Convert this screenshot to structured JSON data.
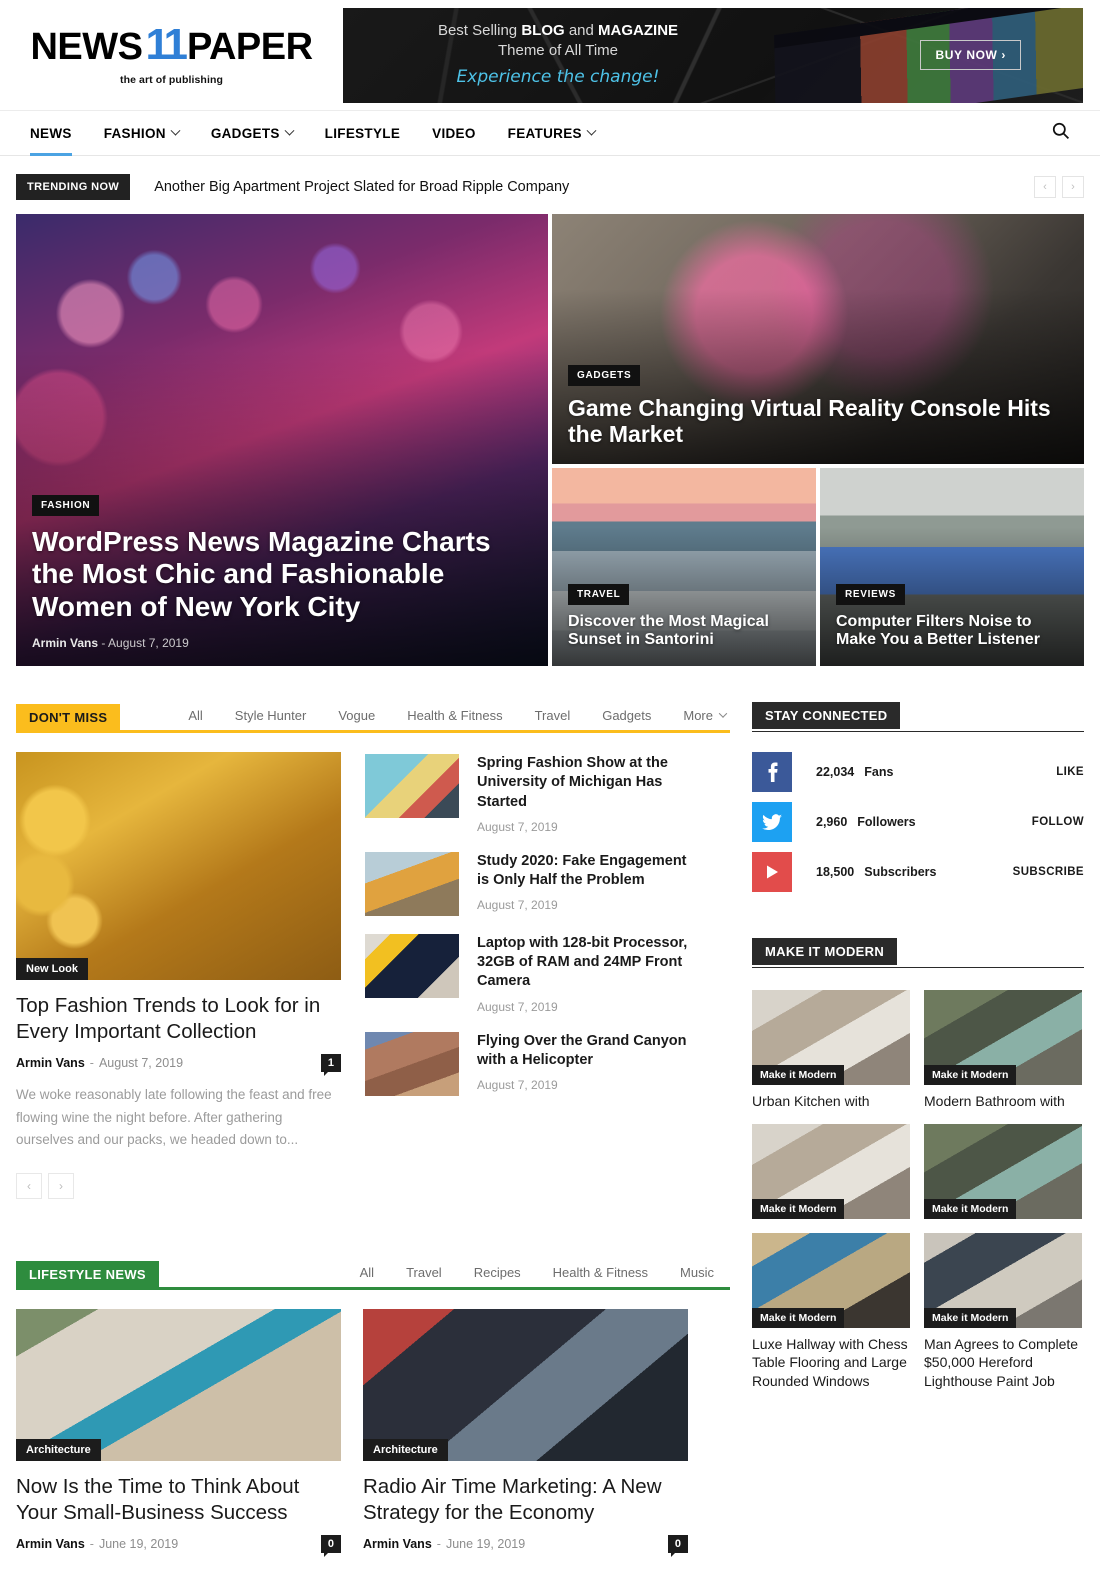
{
  "header": {
    "logo_first": "NEWS",
    "logo_eleven": "11",
    "logo_last": "PAPER",
    "logo_tagline": "the art of publishing",
    "ad": {
      "line1_pre": "Best Selling ",
      "line1_b1": "BLOG",
      "line1_mid": " and ",
      "line1_b2": "MAGAZINE",
      "line2": "Theme of All Time",
      "line3": "Experience the change!",
      "cta": "BUY NOW  ›"
    }
  },
  "nav": {
    "items": [
      {
        "label": "NEWS",
        "caret": false,
        "active": true
      },
      {
        "label": "FASHION",
        "caret": true,
        "active": false
      },
      {
        "label": "GADGETS",
        "caret": true,
        "active": false
      },
      {
        "label": "LIFESTYLE",
        "caret": false,
        "active": false
      },
      {
        "label": "VIDEO",
        "caret": false,
        "active": false
      },
      {
        "label": "FEATURES",
        "caret": true,
        "active": false
      }
    ],
    "search_icon": "search-icon"
  },
  "trending": {
    "badge": "TRENDING NOW",
    "headline": "Another Big Apartment Project Slated for Broad Ripple Company",
    "prev": "‹",
    "next": "›"
  },
  "hero": {
    "main": {
      "category": "FASHION",
      "title": "WordPress News Magazine Charts the Most Chic and Fashionable Women of New York City",
      "author": "Armin Vans",
      "dash": "-",
      "date": "August 7, 2019"
    },
    "top": {
      "category": "GADGETS",
      "title": "Game Changing Virtual Reality Console Hits the Market"
    },
    "bottom": [
      {
        "category": "TRAVEL",
        "title": "Discover the Most Magical Sunset in Santorini"
      },
      {
        "category": "REVIEWS",
        "title": "Computer Filters Noise to Make You a Better Listener"
      }
    ]
  },
  "dont_miss": {
    "badge": "DON'T MISS",
    "tabs": [
      "All",
      "Style Hunter",
      "Vogue",
      "Health & Fitness",
      "Travel",
      "Gadgets"
    ],
    "more": "More",
    "feature": {
      "tag": "New Look",
      "title": "Top Fashion Trends to Look for in Every Important Collection",
      "author": "Armin Vans",
      "dash": "-",
      "date": "August 7, 2019",
      "comments": "1",
      "excerpt": "We woke reasonably late following the feast and free flowing wine the night before. After gathering ourselves and our packs, we headed down to..."
    },
    "pager": {
      "prev": "‹",
      "next": "›"
    },
    "list": [
      {
        "title": "Spring Fashion Show at the University of Michigan Has Started",
        "date": "August 7, 2019",
        "thumb": "img-michigan"
      },
      {
        "title": "Study 2020: Fake Engagement is Only Half the Problem",
        "date": "August 7, 2019",
        "thumb": "img-study"
      },
      {
        "title": "Laptop with 128-bit Processor, 32GB of RAM and 24MP Front Camera",
        "date": "August 7, 2019",
        "thumb": "img-laptop"
      },
      {
        "title": "Flying Over the Grand Canyon with a Helicopter",
        "date": "August 7, 2019",
        "thumb": "img-canyon"
      }
    ]
  },
  "lifestyle": {
    "badge": "LIFESTYLE NEWS",
    "tabs": [
      "All",
      "Travel",
      "Recipes",
      "Health & Fitness",
      "Music"
    ],
    "cards": [
      {
        "tag": "Architecture",
        "title": "Now Is the Time to Think About Your Small-Business Success",
        "author": "Armin Vans",
        "dash": "-",
        "date": "June 19, 2019",
        "comments": "0",
        "thumb": "img-villa"
      },
      {
        "tag": "Architecture",
        "title": "Radio Air Time Marketing: A New Strategy for the Economy",
        "author": "Armin Vans",
        "dash": "-",
        "date": "June 19, 2019",
        "comments": "0",
        "thumb": "img-dj"
      }
    ]
  },
  "sidebar": {
    "stay_connected": {
      "title": "STAY CONNECTED",
      "rows": [
        {
          "icon": "facebook-icon",
          "count": "22,034",
          "label": "Fans",
          "action": "LIKE",
          "color": "#3b5999"
        },
        {
          "icon": "twitter-icon",
          "count": "2,960",
          "label": "Followers",
          "action": "FOLLOW",
          "color": "#1da1f2"
        },
        {
          "icon": "youtube-icon",
          "count": "18,500",
          "label": "Subscribers",
          "action": "SUBSCRIBE",
          "color": "#e24c4b"
        }
      ]
    },
    "make_it_modern": {
      "title": "MAKE IT MODERN",
      "items": [
        {
          "tag": "Make it Modern",
          "title": "Urban Kitchen with",
          "thumb": "img-kitchen"
        },
        {
          "tag": "Make it Modern",
          "title": "Modern Bathroom with",
          "thumb": "img-bath"
        },
        {
          "tag": "Make it Modern",
          "title": "",
          "thumb": "img-kitchen"
        },
        {
          "tag": "Make it Modern",
          "title": "",
          "thumb": "img-bath"
        },
        {
          "tag": "Make it Modern",
          "title": "Luxe Hallway with Chess Table Flooring and Large Rounded Windows",
          "thumb": "img-hallway"
        },
        {
          "tag": "Make it Modern",
          "title": "Man Agrees to Complete $50,000 Hereford Lighthouse Paint Job",
          "thumb": "img-corridor"
        }
      ]
    }
  },
  "colors": {
    "accent_blue": "#4ba3e3",
    "yellow": "#fbbd1d",
    "green": "#2e8c3e",
    "dark": "#1c1c1c"
  }
}
